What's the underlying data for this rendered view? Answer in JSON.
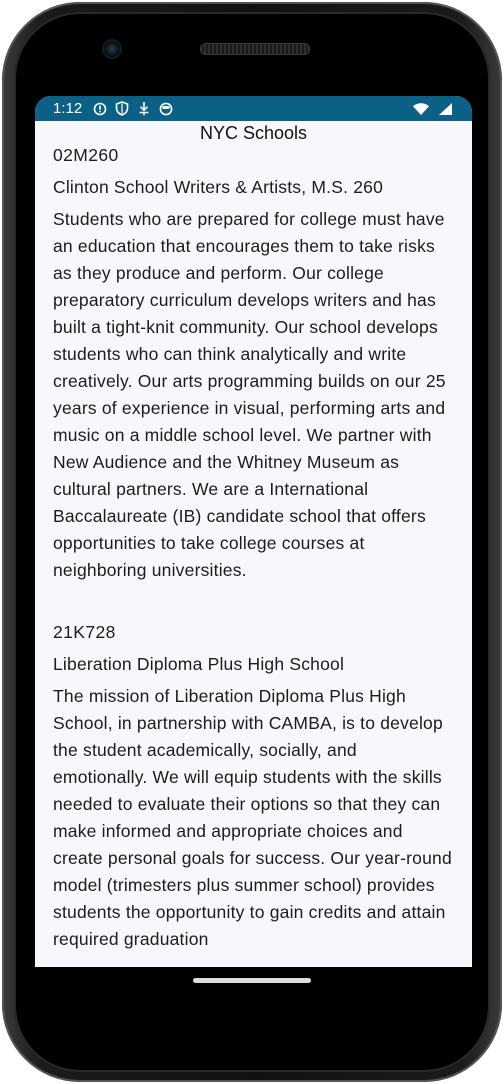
{
  "status_bar": {
    "time": "1:12",
    "icons": [
      "alert-circle-icon",
      "shield-icon",
      "download-arrow-icon",
      "circle-app-icon"
    ],
    "right_icons": [
      "wifi-icon",
      "signal-icon"
    ]
  },
  "app": {
    "title": "NYC Schools"
  },
  "schools": [
    {
      "dbn": "02M260",
      "name": "Clinton School Writers & Artists, M.S. 260",
      "overview": "Students who are prepared for college must have an education that encourages them to take risks as they produce and perform. Our college preparatory curriculum develops writers and has built a tight-knit community. Our school develops students who can think analytically and write creatively. Our arts programming builds on our 25 years of experience in visual, performing arts and music on a middle school level. We partner with New Audience and the Whitney Museum as cultural partners. We are a International Baccalaureate (IB) candidate school that offers opportunities to take college courses at neighboring universities."
    },
    {
      "dbn": "21K728",
      "name": "Liberation Diploma Plus High School",
      "overview": "The mission of Liberation Diploma Plus High School, in partnership with CAMBA, is to develop the student academically, socially, and emotionally. We will equip students with the skills needed to evaluate their options so that they can make informed and appropriate choices and create personal goals for success. Our year-round model (trimesters plus summer school) provides students the opportunity to gain credits and attain required graduation"
    }
  ],
  "colors": {
    "status_bar": "#0b6185",
    "screen_bg": "#f8f8fc",
    "text": "#1c1c1c"
  }
}
